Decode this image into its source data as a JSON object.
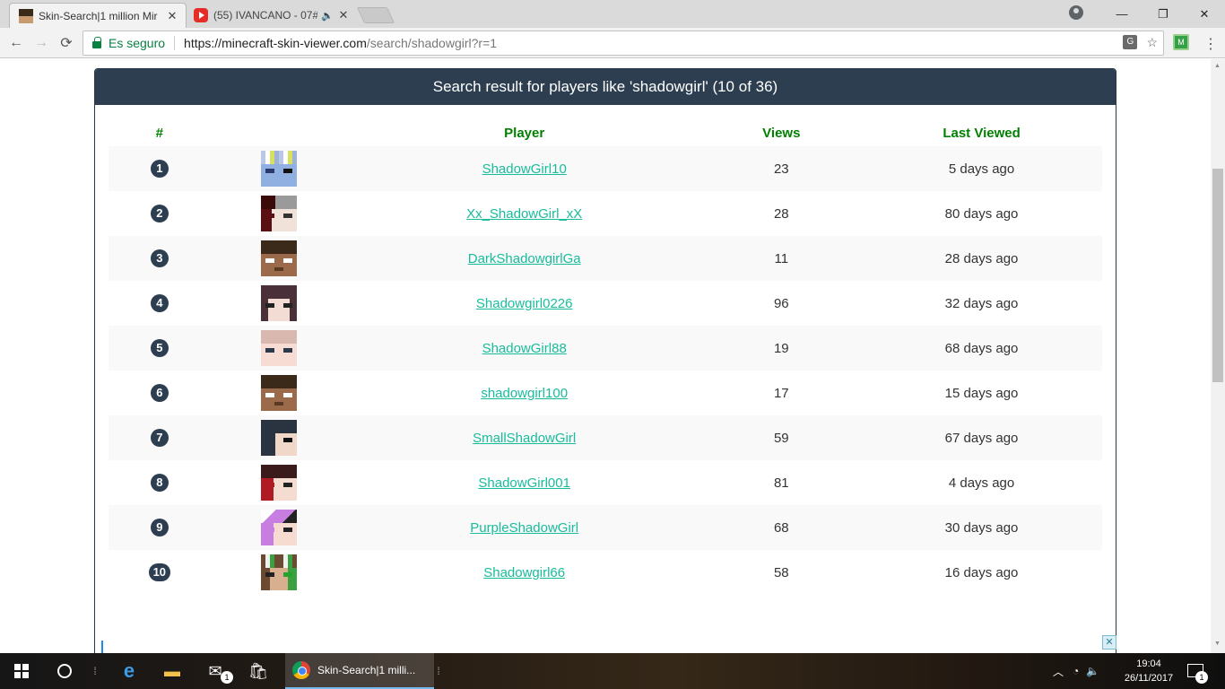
{
  "browser": {
    "tabs": [
      {
        "title": "Skin-Search|1 million Mir",
        "active": true
      },
      {
        "title": "(55) IVANCANO - 07#",
        "active": false
      }
    ],
    "secure_label": "Es seguro",
    "url_host": "https://minecraft-skin-viewer.com",
    "url_path": "/search/shadowgirl?r=1",
    "extension_label": "M"
  },
  "page": {
    "heading": "Search result for players like 'shadowgirl' (10 of 36)",
    "columns": {
      "num": "#",
      "player": "Player",
      "views": "Views",
      "last_viewed": "Last Viewed"
    },
    "rows": [
      {
        "num": "1",
        "player": "ShadowGirl10",
        "views": "23",
        "last_viewed": "5 days ago"
      },
      {
        "num": "2",
        "player": "Xx_ShadowGirl_xX",
        "views": "28",
        "last_viewed": "80 days ago"
      },
      {
        "num": "3",
        "player": "DarkShadowgirlGa",
        "views": "11",
        "last_viewed": "28 days ago"
      },
      {
        "num": "4",
        "player": "Shadowgirl0226",
        "views": "96",
        "last_viewed": "32 days ago"
      },
      {
        "num": "5",
        "player": "ShadowGirl88",
        "views": "19",
        "last_viewed": "68 days ago"
      },
      {
        "num": "6",
        "player": "shadowgirl100",
        "views": "17",
        "last_viewed": "15 days ago"
      },
      {
        "num": "7",
        "player": "SmallShadowGirl",
        "views": "59",
        "last_viewed": "67 days ago"
      },
      {
        "num": "8",
        "player": "ShadowGirl001",
        "views": "81",
        "last_viewed": "4 days ago"
      },
      {
        "num": "9",
        "player": "PurpleShadowGirl",
        "views": "68",
        "last_viewed": "30 days ago"
      },
      {
        "num": "10",
        "player": "Shadowgirl66",
        "views": "58",
        "last_viewed": "16 days ago"
      }
    ]
  },
  "taskbar": {
    "chrome_title": "Skin-Search|1 milli...",
    "mail_badge": "1",
    "time": "19:04",
    "date": "26/11/2017",
    "notification_count": "1"
  },
  "colors": {
    "header_bg": "#2c3e50",
    "column_header": "#008000",
    "link": "#18bc9c"
  }
}
